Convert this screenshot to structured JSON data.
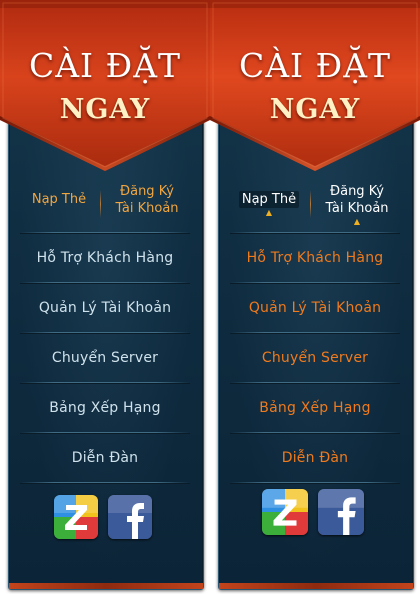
{
  "colors": {
    "banner": "#c6391b",
    "banner_dark": "#8e1f0a",
    "panel_bg": "#12324a",
    "tab_text_default": "#f2a640",
    "tab_text_active": "#ffffff",
    "menu_text_default": "#cfe2ec",
    "menu_text_hover": "#f07a1c",
    "facebook": "#3b5a9a"
  },
  "left": {
    "title_line1": "CÀI ĐẶT",
    "title_line2": "NGAY",
    "tabs": [
      {
        "label": "Nạp Thẻ",
        "caret": ""
      },
      {
        "label_line1": "Đăng Ký",
        "label_line2": "Tài Khoản",
        "caret": ""
      }
    ],
    "menu": [
      {
        "label": "Hỗ Trợ Khách Hàng"
      },
      {
        "label": "Quản Lý Tài Khoản"
      },
      {
        "label": "Chuyển Server"
      },
      {
        "label": "Bảng Xếp Hạng"
      },
      {
        "label": "Diễn Đàn"
      }
    ],
    "social": [
      {
        "name": "zing",
        "icon": "zing-z-icon"
      },
      {
        "name": "facebook",
        "icon": "facebook-f-icon"
      }
    ]
  },
  "right": {
    "title_line1": "CÀI ĐẶT",
    "title_line2": "NGAY",
    "tabs": [
      {
        "label": "Nạp Thẻ",
        "caret": "▲"
      },
      {
        "label_line1": "Đăng Ký",
        "label_line2": "Tài Khoản",
        "caret": "▲"
      }
    ],
    "menu": [
      {
        "label": "Hỗ Trợ Khách Hàng"
      },
      {
        "label": "Quản Lý Tài Khoản"
      },
      {
        "label": "Chuyển Server"
      },
      {
        "label": "Bảng Xếp Hạng"
      },
      {
        "label": "Diễn Đàn"
      }
    ],
    "social": [
      {
        "name": "zing",
        "icon": "zing-z-icon"
      },
      {
        "name": "facebook",
        "icon": "facebook-f-icon"
      }
    ]
  }
}
